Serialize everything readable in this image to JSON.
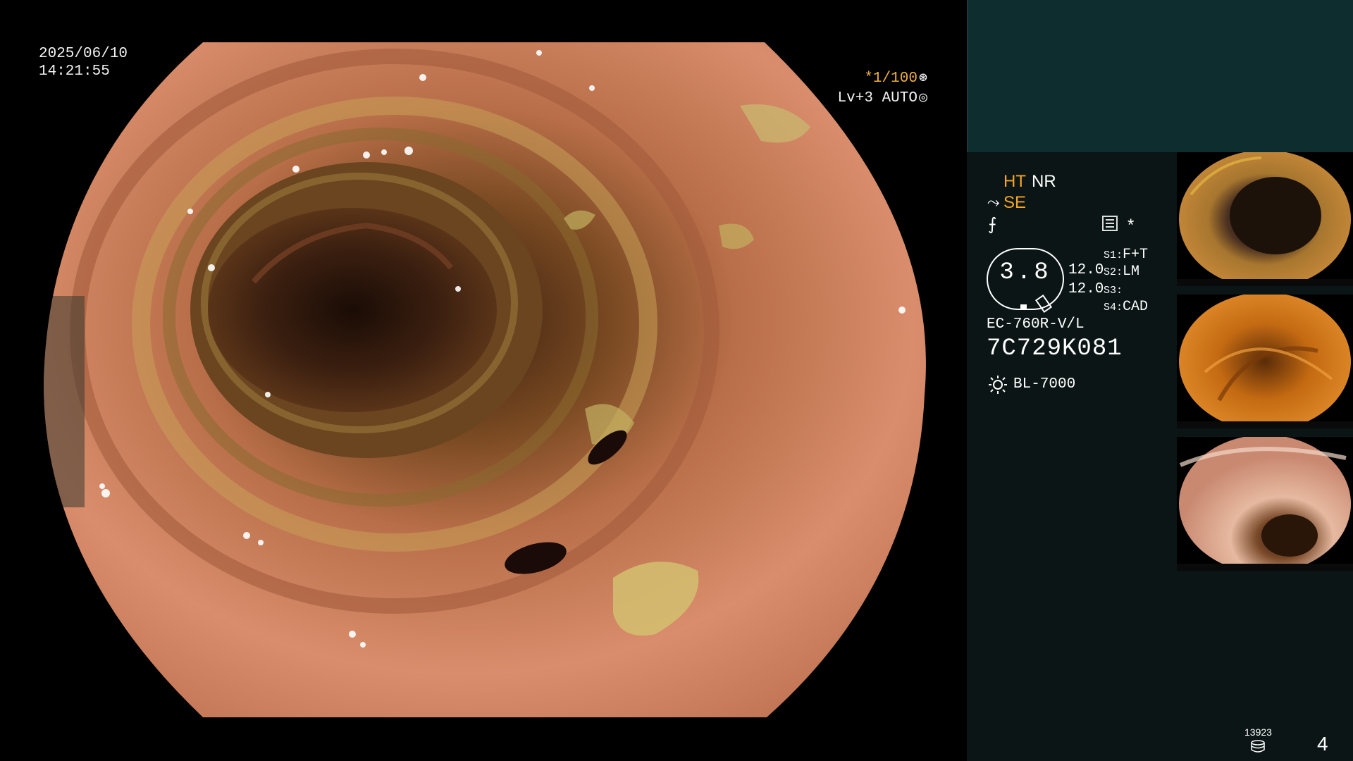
{
  "osd": {
    "date": "2025/06/10",
    "time": "14:21:55",
    "shutter": "*1/100",
    "iris": "Lv+3 AUTO"
  },
  "panel": {
    "enhancement": {
      "ht": "HT",
      "nr": "NR",
      "se": "SE"
    },
    "zoom_ratio": "3.8",
    "zoom_values": [
      "12.0",
      "12.0"
    ],
    "switches": [
      {
        "key": "S1:",
        "value": "F+T"
      },
      {
        "key": "S2:",
        "value": "LM"
      },
      {
        "key": "S3:",
        "value": ""
      },
      {
        "key": "S4:",
        "value": "CAD"
      }
    ],
    "scope_model": "EC-760R-V/L",
    "scope_serial": "7C729K081",
    "light_source": "BL-7000",
    "star": "*",
    "image_count": "13923",
    "page_number": "4",
    "colors": {
      "accent": "#f5a623",
      "panel_top": "#0e2d2f",
      "panel_bg": "#0b1515"
    }
  },
  "thumbnails": [
    {
      "name": "capture-1",
      "tone": "brown"
    },
    {
      "name": "capture-2",
      "tone": "orange"
    },
    {
      "name": "capture-3",
      "tone": "pink"
    }
  ]
}
